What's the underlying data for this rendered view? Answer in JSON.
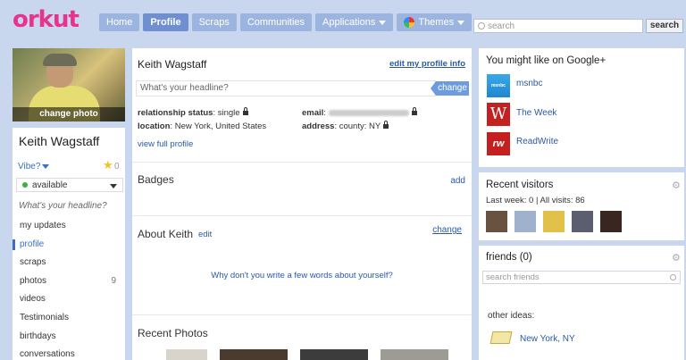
{
  "brand": {
    "logo": "orkut"
  },
  "nav": {
    "home": "Home",
    "profile": "Profile",
    "scraps": "Scraps",
    "communities": "Communities",
    "applications": "Applications",
    "themes": "Themes"
  },
  "search": {
    "placeholder": "search",
    "button": "search"
  },
  "photo": {
    "caption": "change photo"
  },
  "left": {
    "name": "Keith Wagstaff",
    "vibe": "Vibe?",
    "star_count": "0",
    "status": "available",
    "headline": "What's your headline?",
    "menu": [
      {
        "label": "my updates",
        "count": ""
      },
      {
        "label": "profile",
        "count": ""
      },
      {
        "label": "scraps",
        "count": ""
      },
      {
        "label": "photos",
        "count": "9"
      },
      {
        "label": "videos",
        "count": ""
      },
      {
        "label": "Testimonials",
        "count": ""
      },
      {
        "label": "birthdays",
        "count": ""
      },
      {
        "label": "conversations",
        "count": ""
      }
    ]
  },
  "profile": {
    "name": "Keith Wagstaff",
    "edit_link": "edit my profile info",
    "headline_placeholder": "What's your headline?",
    "change_button": "change",
    "relationship_label": "relationship status",
    "relationship_value": "single",
    "location_label": "location",
    "location_value": "New York, United States",
    "email_label": "email",
    "address_label": "address",
    "address_value": "county: NY",
    "view_full": "view full profile",
    "badges_title": "Badges",
    "badges_add": "add",
    "about_title": "About Keith",
    "about_edit": "edit",
    "about_change": "change",
    "about_prompt": "Why don't you write a few words about yourself?",
    "recent_photos_title": "Recent Photos"
  },
  "google_plus": {
    "title": "You might like on Google+",
    "items": [
      {
        "name": "msnbc",
        "logo_text": "msnbc"
      },
      {
        "name": "The Week",
        "logo_text": "W"
      },
      {
        "name": "ReadWrite",
        "logo_text": "rw"
      }
    ]
  },
  "visitors": {
    "title": "Recent visitors",
    "stats": "Last week: 0 | All visits: 86"
  },
  "friends": {
    "title": "friends (0)",
    "search_placeholder": "search friends",
    "other_ideas": "other ideas:",
    "suggestion": "New York, NY"
  },
  "colors": {
    "brand": "#e8328d",
    "link": "#2a59a8",
    "nav": "#9bb5e0",
    "background": "#c8d7ee"
  }
}
